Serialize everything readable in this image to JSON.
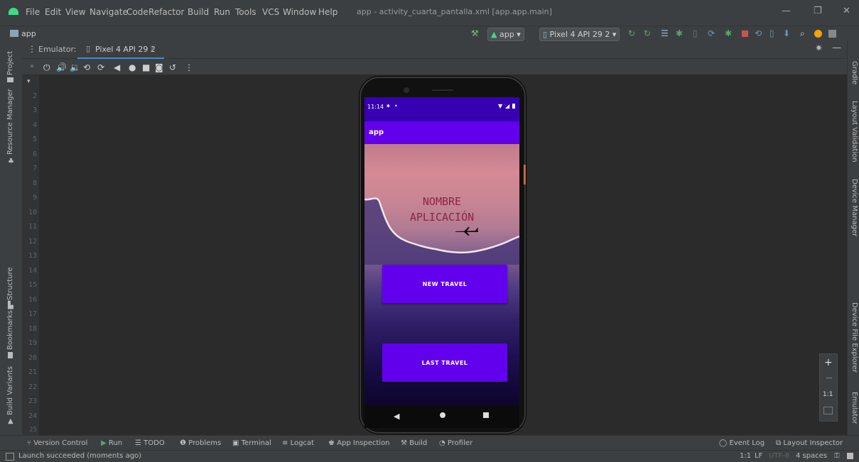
{
  "menu": [
    "File",
    "Edit",
    "View",
    "Navigate",
    "Code",
    "Refactor",
    "Build",
    "Run",
    "Tools",
    "VCS",
    "Window",
    "Help"
  ],
  "window_title": "app - activity_cuarta_pantalla.xml [app.app.main]",
  "project_name": "app",
  "run_config": "app",
  "device_selector": "Pixel 4 API 29 2",
  "emulator_label": "Emulator:",
  "emulator_tab": "Pixel 4 API 29 2",
  "line_numbers": [
    "2",
    "3",
    "4",
    "5",
    "6",
    "7",
    "8",
    "9",
    "10",
    "11",
    "12",
    "13",
    "14",
    "15",
    "16",
    "17",
    "18",
    "19",
    "20",
    "21",
    "22",
    "23",
    "24",
    "25"
  ],
  "left_tabs": [
    "Project",
    "Resource Manager",
    "Structure",
    "Bookmarks",
    "Build Variants"
  ],
  "right_tabs": [
    "Gradle",
    "Layout Validation",
    "Device Manager",
    "Device File Explorer",
    "Emulator"
  ],
  "phone": {
    "time": "11:14",
    "app_title": "app",
    "hero_title_line1": "NOMBRE",
    "hero_title_line2": "APLICACIÓN",
    "button_new": "NEW TRAVEL",
    "button_last": "LAST TRAVEL"
  },
  "zoom": {
    "plus": "+",
    "minus": "−",
    "one_to_one": "1:1"
  },
  "bottom_tools": [
    "Version Control",
    "Run",
    "TODO",
    "Problems",
    "Terminal",
    "Logcat",
    "App Inspection",
    "Build",
    "Profiler"
  ],
  "bottom_right_tools": [
    "Event Log",
    "Layout Inspector"
  ],
  "status_message": "Launch succeeded (moments ago)",
  "status_right": {
    "position": "1:1",
    "line_sep": "LF",
    "encoding": "UTF-8",
    "indent": "4 spaces"
  },
  "colors": {
    "primary": "#6200ee",
    "primary_dark": "#3700b3",
    "ide_bg": "#2b2b2b"
  }
}
